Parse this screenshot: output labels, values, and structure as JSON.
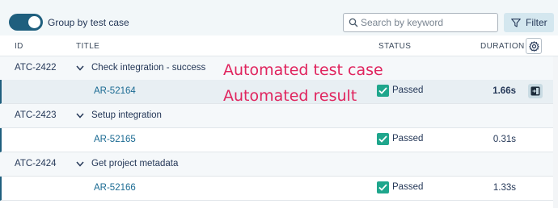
{
  "toolbar": {
    "toggle_on": true,
    "toggle_label": "Group by test case",
    "search_placeholder": "Search by keyword",
    "filter_label": "Filter"
  },
  "columns": {
    "id": "ID",
    "title": "TITLE",
    "status": "STATUS",
    "duration": "DURATION"
  },
  "groups": [
    {
      "id": "ATC-2422",
      "title": "Check integration - success",
      "result": {
        "id": "AR-52164",
        "status": "Passed",
        "duration": "1.66s",
        "selected": true
      }
    },
    {
      "id": "ATC-2423",
      "title": "Setup integration",
      "result": {
        "id": "AR-52165",
        "status": "Passed",
        "duration": "0.31s",
        "selected": false
      }
    },
    {
      "id": "ATC-2424",
      "title": "Get project metadata",
      "result": {
        "id": "AR-52166",
        "status": "Passed",
        "duration": "1.33s",
        "selected": false
      }
    }
  ],
  "annotations": {
    "test_case": "Automated test case",
    "result": "Automated result"
  },
  "colors": {
    "accent": "#1f5f7e",
    "passed": "#1fa68c",
    "link": "#1b6b93",
    "annotation": "#e0245e"
  }
}
